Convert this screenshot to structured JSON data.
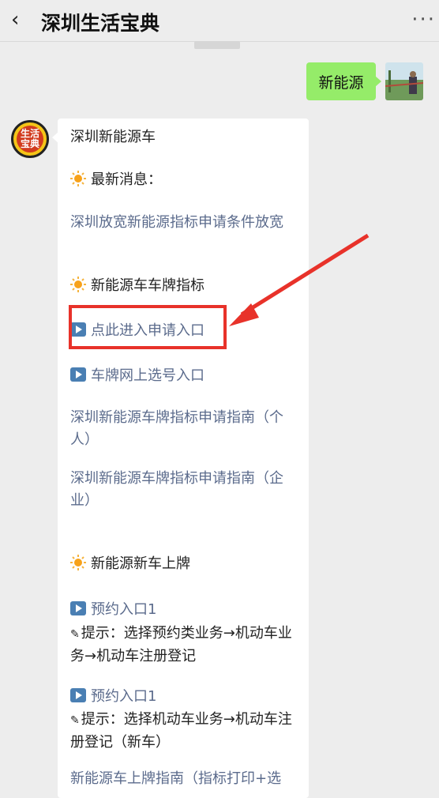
{
  "header": {
    "back_icon": "back-arrow-icon",
    "title": "深圳生活宝典",
    "more": "···"
  },
  "user_message": {
    "text": "新能源"
  },
  "bot_avatar": {
    "label": "生活\n宝典"
  },
  "article": {
    "title": "深圳新能源车",
    "section1": {
      "heading": "最新消息：",
      "link": "深圳放宽新能源指标申请条件放宽"
    },
    "section2": {
      "heading": "新能源车车牌指标",
      "apply_entry": "点此进入申请入口",
      "select_entry": "车牌网上选号入口",
      "guide_personal": "深圳新能源车牌指标申请指南（个人）",
      "guide_company": "深圳新能源车牌指标申请指南（企业）"
    },
    "section3": {
      "heading": "新能源新车上牌",
      "entry1": "预约入口1",
      "tip1": "提示：选择预约类业务→机动车业务→机动车注册登记",
      "entry2": "预约入口1",
      "tip2": "提示：选择机动车业务→机动车注册登记（新车）",
      "guide": "新能源车上牌指南（指标打印+选"
    }
  },
  "colors": {
    "link": "#5b6b8c",
    "highlight": "#e8322a",
    "user_bubble": "#95ec69"
  }
}
